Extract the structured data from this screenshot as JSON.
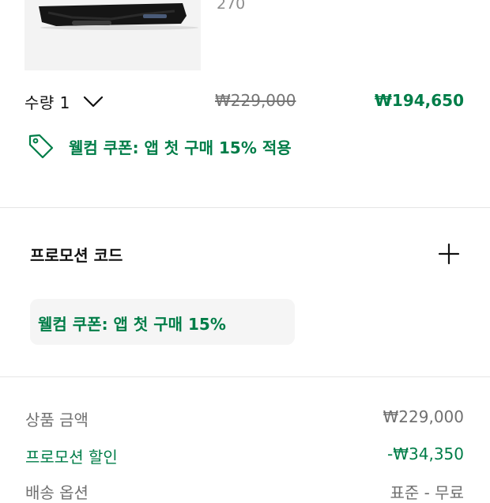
{
  "product": {
    "size": "270"
  },
  "quantity": {
    "label": "수량 1"
  },
  "price": {
    "original": "₩229,000",
    "sale": "₩194,650"
  },
  "coupon": {
    "text": "웰컴 쿠폰: 앱 첫 구매 15% 적용"
  },
  "promo": {
    "title": "프로모션 코드",
    "chip_text": "웰컴 쿠폰: 앱 첫 구매 15%"
  },
  "summary": {
    "rows": [
      {
        "label": "상품 금액",
        "value": "₩229,000"
      },
      {
        "label": "프로모션 할인",
        "value": "-₩34,350"
      },
      {
        "label": "배송 옵션",
        "value": "표준 - 무료"
      }
    ]
  },
  "colors": {
    "accent_green": "#007d48",
    "muted_text": "#707070",
    "chip_bg": "#f5f5f5"
  },
  "icons": [
    "chevron-down-icon",
    "price-tag-icon",
    "plus-icon"
  ]
}
